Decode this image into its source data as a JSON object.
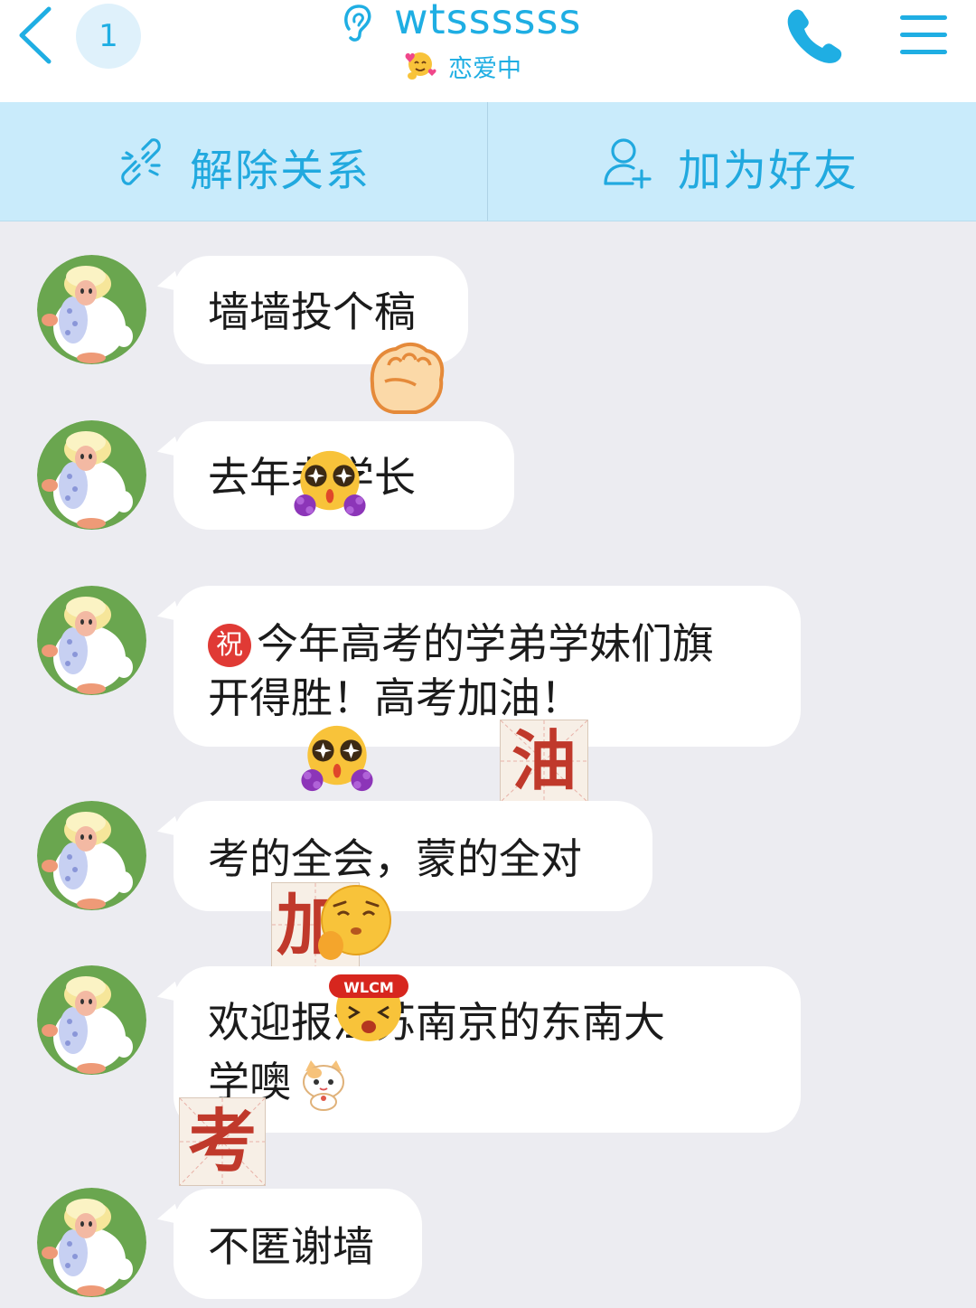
{
  "header": {
    "unread_count": "1",
    "contact_name": "wtssssss",
    "status": "恋爱中"
  },
  "action_bar": {
    "unbind_label": "解除关系",
    "add_friend_label": "加为好友"
  },
  "messages": [
    {
      "text": "墙墙投个稿"
    },
    {
      "text": "去年老学长"
    },
    {
      "badge": "祝",
      "line1": "今年高考的学弟学妹们旗",
      "line2": "开得胜！高考加油！"
    },
    {
      "text": "考的全会，蒙的全对"
    },
    {
      "line1": "欢迎报江苏南京的东南大",
      "line2": "学噢"
    },
    {
      "text": "不匿谢墙"
    }
  ],
  "stickers": {
    "you_char": "油",
    "jia_char": "加",
    "kao_char": "考",
    "wlcm_text": "WLCM"
  },
  "colors": {
    "accent": "#1faee3",
    "action_bar_bg": "#c9ebfb",
    "chat_bg": "#ececf1",
    "bubble_bg": "#ffffff",
    "text": "#1b1b1b",
    "sticker_red": "#c0392b"
  },
  "icons": {
    "back": "chevron-left-icon",
    "ear": "ear-icon",
    "status": "hug-emoji-icon",
    "phone": "phone-icon",
    "menu": "menu-icon",
    "unbind": "broken-link-icon",
    "add_friend": "add-user-icon"
  }
}
